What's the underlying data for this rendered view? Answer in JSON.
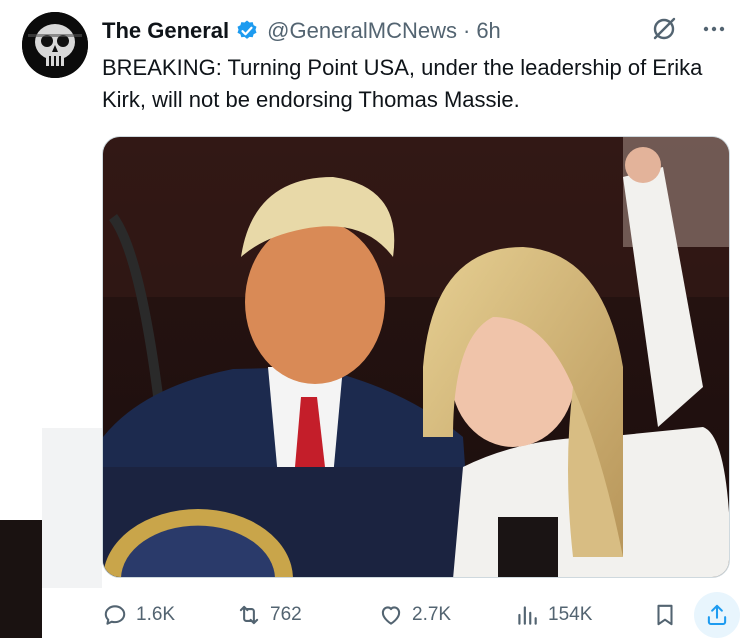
{
  "tweet": {
    "display_name": "The General",
    "handle": "@GeneralMCNews",
    "separator": "·",
    "time": "6h",
    "text": "BREAKING: Turning Point USA, under the leadership of Erika Kirk, will not be endorsing Thomas Massie."
  },
  "icons": {
    "avatar": "skull-emblem-avatar",
    "verified": "verified-badge-icon",
    "grok": "grok-icon",
    "more": "more-icon"
  },
  "actions": {
    "replies": "1.6K",
    "reposts": "762",
    "likes": "2.7K",
    "views": "154K"
  },
  "colors": {
    "text": "#0f1419",
    "secondary": "#536471",
    "verified": "#1d9bf0",
    "share_highlight": "#e8f5fd"
  }
}
